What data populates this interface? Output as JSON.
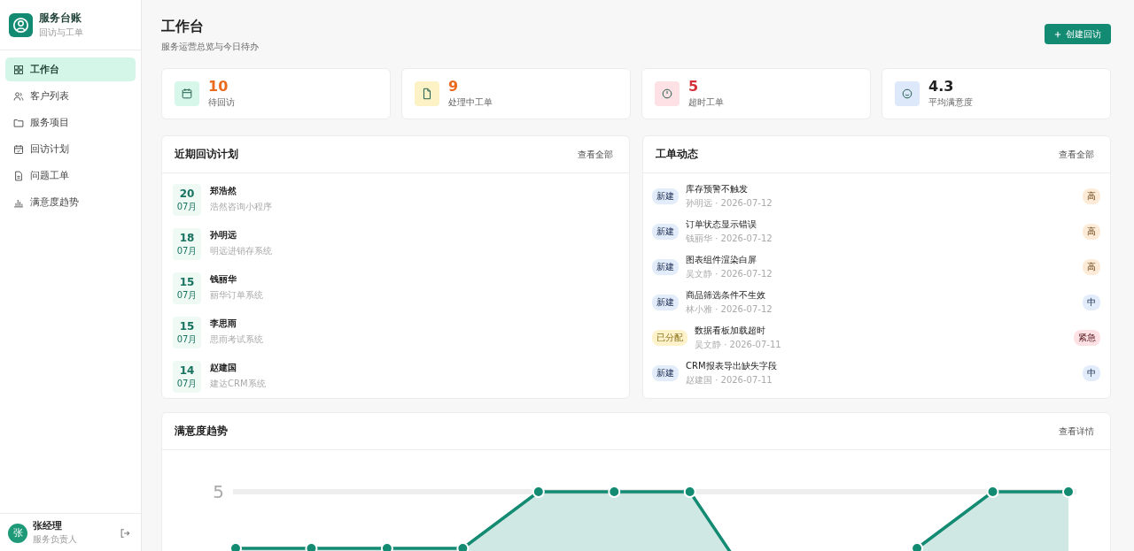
{
  "sidebar": {
    "brand": {
      "title": "服务台账",
      "subtitle": "回访与工单"
    },
    "items": [
      {
        "label": "工作台",
        "kind": "grid",
        "selected": true
      },
      {
        "label": "客户列表",
        "kind": "users",
        "selected": false
      },
      {
        "label": "服务项目",
        "kind": "folder",
        "selected": false
      },
      {
        "label": "回访计划",
        "kind": "calendar",
        "selected": false
      },
      {
        "label": "问题工单",
        "kind": "file",
        "selected": false
      },
      {
        "label": "满意度趋势",
        "kind": "bars",
        "selected": false
      }
    ],
    "user": {
      "avatar": "张",
      "name": "张经理",
      "role": "服务负责人"
    }
  },
  "header": {
    "title": "工作台",
    "subtitle": "服务运营总览与今日待办",
    "action": "创建回访"
  },
  "stats": [
    {
      "value": "10",
      "label": "待回访",
      "kind": "calendar",
      "color": "#ea6a1e"
    },
    {
      "value": "9",
      "label": "处理中工单",
      "kind": "file",
      "color": "#ea6a1e"
    },
    {
      "value": "5",
      "label": "超时工单",
      "kind": "clock",
      "color": "#d4313b"
    },
    {
      "value": "4.3",
      "label": "平均满意度",
      "kind": "smile",
      "color": "#222222"
    }
  ],
  "visits": {
    "title": "近期回访计划",
    "link": "查看全部",
    "rows": [
      {
        "day": "20",
        "month": "07月",
        "name": "郑浩然",
        "project": "浩然咨询小程序"
      },
      {
        "day": "18",
        "month": "07月",
        "name": "孙明远",
        "project": "明远进销存系统"
      },
      {
        "day": "15",
        "month": "07月",
        "name": "钱丽华",
        "project": "丽华订单系统"
      },
      {
        "day": "15",
        "month": "07月",
        "name": "李思雨",
        "project": "思雨考试系统"
      },
      {
        "day": "14",
        "month": "07月",
        "name": "赵建国",
        "project": "建达CRM系统"
      }
    ]
  },
  "tickets": {
    "title": "工单动态",
    "link": "查看全部",
    "rows": [
      {
        "status": {
          "label": "新建",
          "color": "#e3ecfb"
        },
        "title": "库存预警不触发",
        "meta": "孙明远 · 2026-07-12",
        "priority": {
          "label": "高",
          "color": "#fdebd7"
        }
      },
      {
        "status": {
          "label": "新建",
          "color": "#e3ecfb"
        },
        "title": "订单状态显示错误",
        "meta": "钱丽华 · 2026-07-12",
        "priority": {
          "label": "高",
          "color": "#fdebd7"
        }
      },
      {
        "status": {
          "label": "新建",
          "color": "#e3ecfb"
        },
        "title": "图表组件渲染白屏",
        "meta": "吴文静 · 2026-07-12",
        "priority": {
          "label": "高",
          "color": "#fdebd7"
        }
      },
      {
        "status": {
          "label": "新建",
          "color": "#e3ecfb"
        },
        "title": "商品筛选条件不生效",
        "meta": "林小雅 · 2026-07-12",
        "priority": {
          "label": "中",
          "color": "#e3ecfb"
        }
      },
      {
        "status": {
          "label": "已分配",
          "color": "#fdf2c9"
        },
        "title": "数据看板加载超时",
        "meta": "吴文静 · 2026-07-11",
        "priority": {
          "label": "紧急",
          "color": "#fde1e4"
        }
      },
      {
        "status": {
          "label": "新建",
          "color": "#e3ecfb"
        },
        "title": "CRM报表导出缺失字段",
        "meta": "赵建国 · 2026-07-11",
        "priority": {
          "label": "中",
          "color": "#e3ecfb"
        }
      }
    ]
  },
  "trend": {
    "title": "满意度趋势",
    "link": "查看详情",
    "axis_label": "5"
  }
}
